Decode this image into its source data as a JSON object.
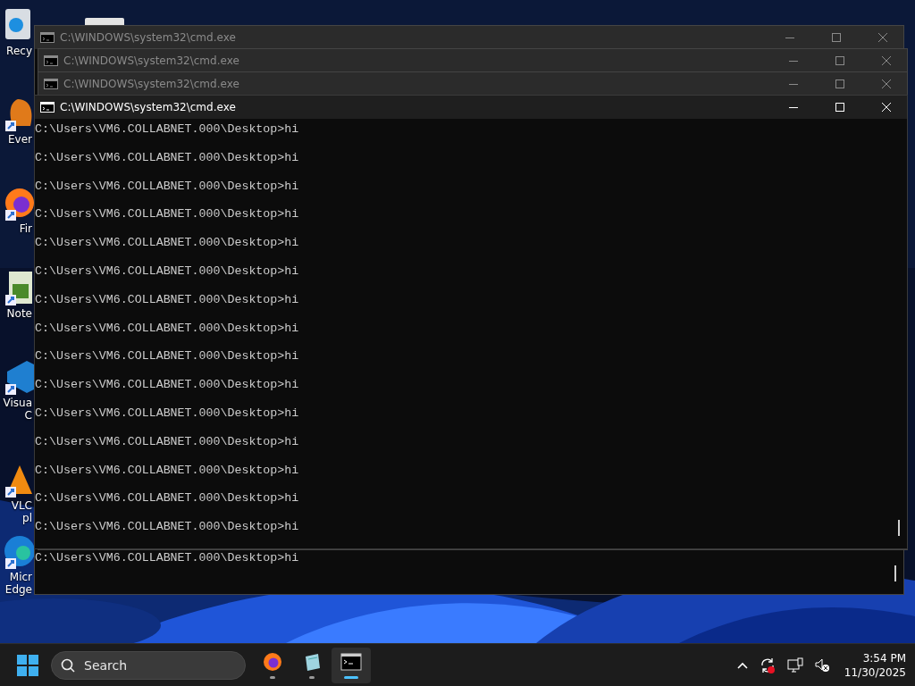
{
  "desktop_icons": [
    {
      "kind": "recycle",
      "label_lines": [
        "Recy"
      ]
    },
    {
      "kind": "settings"
    },
    {
      "kind": "evernote",
      "label_lines": [
        "Ever"
      ]
    },
    {
      "kind": "firefox",
      "label_lines": [
        "Fir"
      ]
    },
    {
      "kind": "notepad",
      "label_lines": [
        "Note"
      ]
    },
    {
      "kind": "vscode",
      "label_lines": [
        "Visua",
        "C"
      ]
    },
    {
      "kind": "vlc",
      "label_lines": [
        "VLC",
        "pl"
      ]
    },
    {
      "kind": "edge",
      "label_lines": [
        "Micr",
        "Edge"
      ]
    }
  ],
  "windows": [
    {
      "title": "C:\\WINDOWS\\system32\\cmd.exe",
      "active": false,
      "lines": [
        "C:\\Users\\VM6.COLLABNET.000\\Desktop>hi"
      ]
    },
    {
      "title": "C:\\WINDOWS\\system32\\cmd.exe",
      "active": false
    },
    {
      "title": "C:\\WINDOWS\\system32\\cmd.exe",
      "active": false
    },
    {
      "title": "C:\\WINDOWS\\system32\\cmd.exe",
      "active": true,
      "lines": [
        "C:\\Users\\VM6.COLLABNET.000\\Desktop>hi",
        "C:\\Users\\VM6.COLLABNET.000\\Desktop>hi",
        "C:\\Users\\VM6.COLLABNET.000\\Desktop>hi",
        "C:\\Users\\VM6.COLLABNET.000\\Desktop>hi",
        "C:\\Users\\VM6.COLLABNET.000\\Desktop>hi",
        "C:\\Users\\VM6.COLLABNET.000\\Desktop>hi",
        "C:\\Users\\VM6.COLLABNET.000\\Desktop>hi",
        "C:\\Users\\VM6.COLLABNET.000\\Desktop>hi",
        "C:\\Users\\VM6.COLLABNET.000\\Desktop>hi",
        "C:\\Users\\VM6.COLLABNET.000\\Desktop>hi",
        "C:\\Users\\VM6.COLLABNET.000\\Desktop>hi",
        "C:\\Users\\VM6.COLLABNET.000\\Desktop>hi",
        "C:\\Users\\VM6.COLLABNET.000\\Desktop>hi",
        "C:\\Users\\VM6.COLLABNET.000\\Desktop>hi",
        "C:\\Users\\VM6.COLLABNET.000\\Desktop>hi"
      ]
    }
  ],
  "taskbar": {
    "search": {
      "placeholder": "Search"
    },
    "apps": [
      {
        "kind": "firefox",
        "active": false
      },
      {
        "kind": "notepad",
        "active": false
      },
      {
        "kind": "terminal",
        "active": true
      }
    ],
    "clock": {
      "time": "3:54 PM",
      "date": "11/30/2025"
    }
  }
}
